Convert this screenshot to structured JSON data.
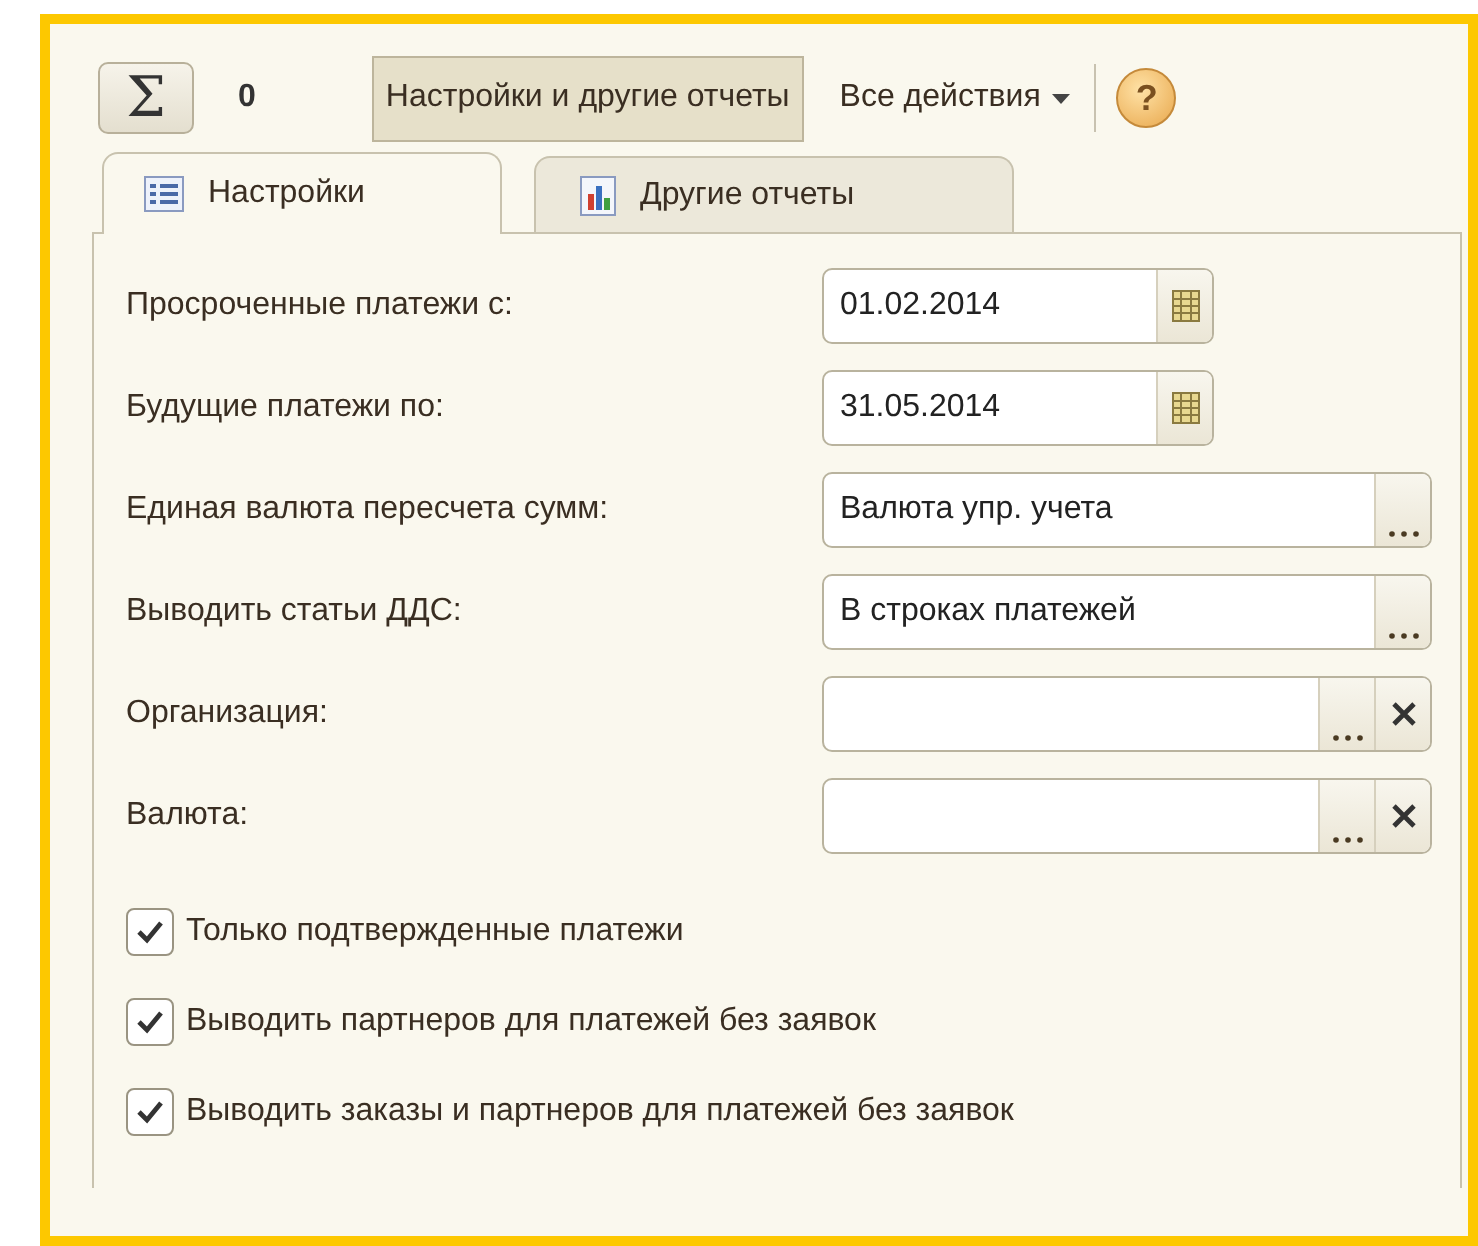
{
  "toolbar": {
    "sum_button": "Σ",
    "sum_value": "0",
    "settings_button": {
      "label": "Настройки и другие отчеты",
      "selected": true
    },
    "actions_menu": "Все действия",
    "help": "?"
  },
  "tabs": [
    {
      "label": "Настройки",
      "kind": "list",
      "selected": true
    },
    {
      "label": "Другие отчеты",
      "kind": "chart",
      "selected": false
    }
  ],
  "fields": [
    {
      "label": "Просроченные платежи с:",
      "kind": "date",
      "value": "01.02.2014"
    },
    {
      "label": "Будущие платежи по:",
      "kind": "date",
      "value": "31.05.2014"
    },
    {
      "label": "Единая валюта пересчета сумм:",
      "kind": "choice",
      "value": "Валюта упр. учета"
    },
    {
      "label": "Выводить статьи ДДС:",
      "kind": "choice",
      "value": "В строках платежей"
    },
    {
      "label": "Организация:",
      "kind": "clearable"
    },
    {
      "label": "Валюта:",
      "kind": "clearable"
    }
  ],
  "checkboxes": [
    {
      "label": "Только подтвержденные платежи",
      "checked": true
    },
    {
      "label": "Выводить партнеров для платежей без заявок",
      "checked": true
    },
    {
      "label": "Выводить заказы и партнеров для платежей без заявок",
      "checked": true
    }
  ]
}
